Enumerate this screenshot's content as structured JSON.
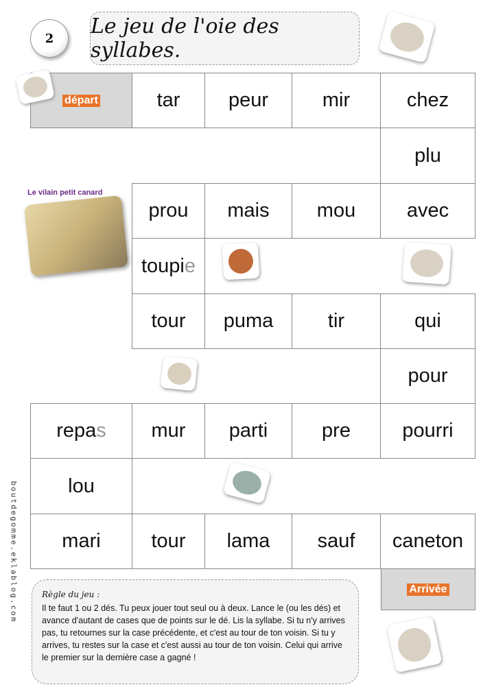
{
  "page_number": "2",
  "title": "Le jeu de l'oie des syllabes.",
  "start_label": "départ",
  "end_label": "Arrivée",
  "illustration_caption": "Le vilain petit canard",
  "cells": {
    "r0": [
      "tar",
      "peur",
      "mir",
      "chez"
    ],
    "r1": [
      "plu"
    ],
    "r2": [
      "prou",
      "mais",
      "mou",
      "avec"
    ],
    "r3": {
      "main": "toupi",
      "faded": "e"
    },
    "r4": [
      "tour",
      "puma",
      "tir",
      "qui"
    ],
    "r5": [
      "pour"
    ],
    "r6": {
      "first_main": "repa",
      "first_faded": "s",
      "rest": [
        "mur",
        "parti",
        "pre",
        "pourri"
      ]
    },
    "r7": [
      "lou"
    ],
    "r8": [
      "mari",
      "tour",
      "lama",
      "sauf",
      "caneton"
    ]
  },
  "rules": {
    "heading": "Règle du jeu :",
    "text": "Il te faut 1 ou 2 dés. Tu peux jouer tout seul ou à deux. Lance le (ou les dés) et avance d'autant de cases que de points sur le dé. Lis la syllabe. Si tu n'y arrives pas, tu retournes sur la case précédente, et c'est au tour de ton voisin. Si tu y arrives, tu restes sur la case et c'est aussi au tour de ton voisin. Celui qui arrive le premier sur la dernière case a gagné !"
  },
  "side_text": "boutdegomme.eklablog.com",
  "colors": {
    "cutout_orange": "#e8742a",
    "cutout_red": "#d62020",
    "start_cell": "#d8d8d8"
  }
}
